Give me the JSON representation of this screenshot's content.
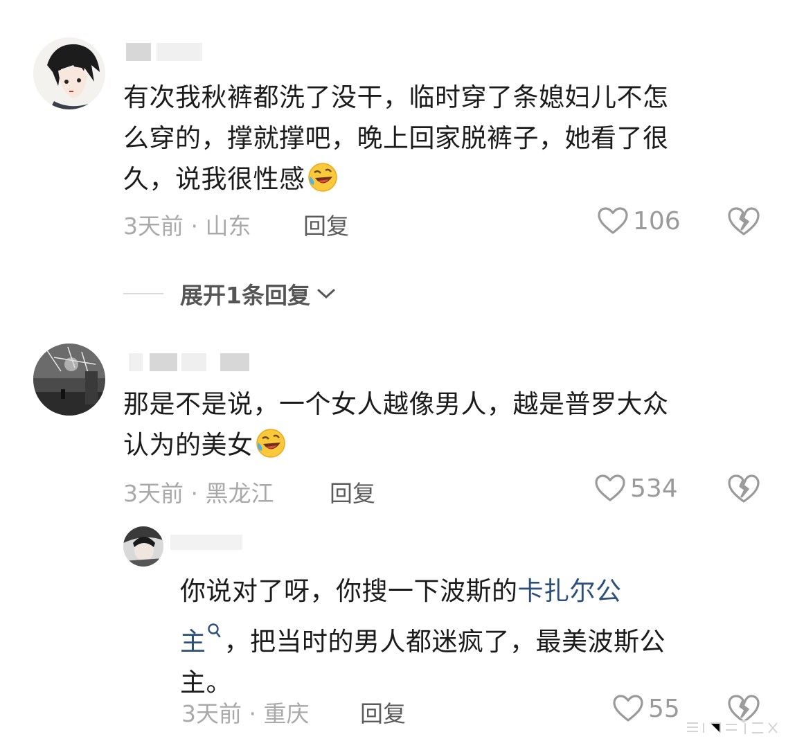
{
  "comments": [
    {
      "text_lines": [
        "有次我秋裤都洗了没干，临时穿了条媳妇儿不怎",
        "么穿的，撑就撑吧，晚上回家脱裤子，她看了很",
        "久，说我很性感"
      ],
      "emoji": "rofl-emoji",
      "time": "3天前",
      "location": "山东",
      "reply_label": "回复",
      "likes": "106",
      "expand_label": "展开1条回复"
    },
    {
      "text_lines": [
        "那是不是说，一个女人越像男人，越是普罗大众",
        "认为的美女"
      ],
      "emoji": "rofl-emoji",
      "time": "3天前",
      "location": "黑龙江",
      "reply_label": "回复",
      "likes": "534"
    }
  ],
  "reply": {
    "line1_pre": "你说对了呀，你搜一下波斯的",
    "line1_link": "卡扎尔公",
    "line2_link": "主",
    "line2_post": "，把当时的男人都迷疯了，最美波斯公",
    "line3": "主。",
    "time": "3天前",
    "location": "重庆",
    "reply_label": "回复",
    "likes": "55"
  },
  "separator": "·",
  "colors": {
    "link": "#2c4f7c",
    "meta": "#a9a9a9",
    "text": "#1b1b1b"
  },
  "icons": [
    "heart-outline-icon",
    "broken-heart-icon",
    "chevron-down-icon",
    "search-icon"
  ]
}
